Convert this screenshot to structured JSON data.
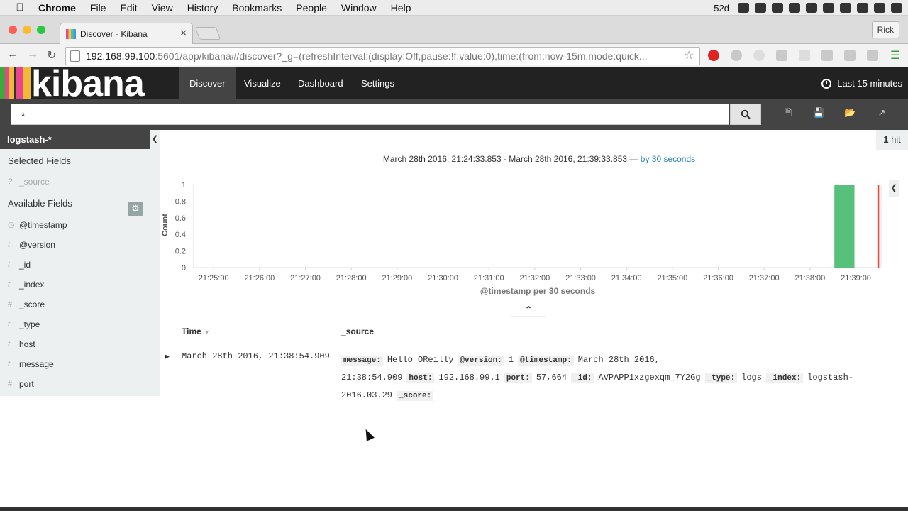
{
  "menubar": {
    "app": "Chrome",
    "items": [
      "File",
      "Edit",
      "View",
      "History",
      "Bookmarks",
      "People",
      "Window",
      "Help"
    ],
    "badge": "52d"
  },
  "browser": {
    "tab_title": "Discover - Kibana",
    "user": "Rick",
    "url_host": "192.168.99.100",
    "url_rest": ":5601/app/kibana#/discover?_g=(refreshInterval:(display:Off,pause:!f,value:0),time:(from:now-15m,mode:quick..."
  },
  "kibana": {
    "logo": "kibana",
    "nav": [
      "Discover",
      "Visualize",
      "Dashboard",
      "Settings"
    ],
    "time_picker": "Last 15 minutes",
    "query": "*"
  },
  "sidebar": {
    "index": "logstash-*",
    "selected_header": "Selected Fields",
    "selected_fields": [
      {
        "type": "?",
        "name": "_source"
      }
    ],
    "available_header": "Available Fields",
    "available_fields": [
      {
        "type": "clock",
        "name": "@timestamp"
      },
      {
        "type": "t",
        "name": "@version"
      },
      {
        "type": "t",
        "name": "_id"
      },
      {
        "type": "t",
        "name": "_index"
      },
      {
        "type": "#",
        "name": "_score"
      },
      {
        "type": "t",
        "name": "_type"
      },
      {
        "type": "t",
        "name": "host"
      },
      {
        "type": "t",
        "name": "message"
      },
      {
        "type": "#",
        "name": "port"
      }
    ]
  },
  "results": {
    "hits_count": "1",
    "hits_label": "hit",
    "range_text": "March 28th 2016, 21:24:33.853 - March 28th 2016, 21:39:33.853 —",
    "interval_link": "by 30 seconds",
    "col_time": "Time",
    "col_source": "_source",
    "row": {
      "time": "March 28th 2016, 21:38:54.909",
      "source": [
        {
          "k": "message:",
          "v": "Hello OReilly"
        },
        {
          "k": "@version:",
          "v": "1"
        },
        {
          "k": "@timestamp:",
          "v": "March 28th 2016, 21:38:54.909"
        },
        {
          "k": "host:",
          "v": "192.168.99.1"
        },
        {
          "k": "port:",
          "v": "57,664"
        },
        {
          "k": "_id:",
          "v": "AVPAPP1xzgexqm_7Y2Gg"
        },
        {
          "k": "_type:",
          "v": "logs"
        },
        {
          "k": "_index:",
          "v": "logstash-2016.03.29"
        },
        {
          "k": "_score:",
          "v": ""
        }
      ]
    }
  },
  "chart_data": {
    "type": "bar",
    "ylabel": "Count",
    "xlabel": "@timestamp per 30 seconds",
    "ylim": [
      0,
      1
    ],
    "yticks": [
      "0",
      "0.2",
      "0.4",
      "0.6",
      "0.8",
      "1"
    ],
    "xticks": [
      "21:25:00",
      "21:26:00",
      "21:27:00",
      "21:28:00",
      "21:29:00",
      "21:30:00",
      "21:31:00",
      "21:32:00",
      "21:33:00",
      "21:34:00",
      "21:35:00",
      "21:36:00",
      "21:37:00",
      "21:38:00",
      "21:39:00"
    ],
    "x_start_min": 24.564,
    "x_end_min": 39.564,
    "bars": [
      {
        "x": "21:38:30",
        "x_min": 38.5,
        "width_min": 0.5,
        "value": 1
      }
    ],
    "now_marker": "21:39:33",
    "bar_color": "#57c17b",
    "now_color": "#e74c3c"
  }
}
